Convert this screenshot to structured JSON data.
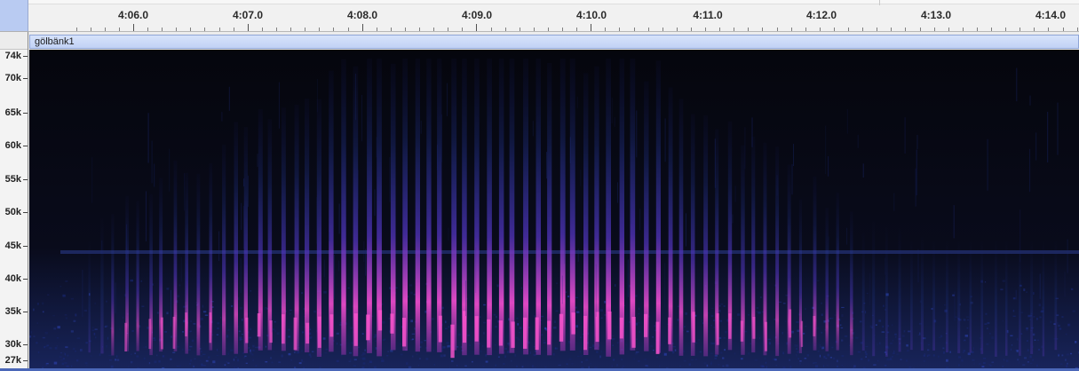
{
  "timeline": {
    "ticks": [
      {
        "label": "4:06.0"
      },
      {
        "label": "4:07.0"
      },
      {
        "label": "4:08.0"
      },
      {
        "label": "4:09.0"
      },
      {
        "label": "4:10.0"
      },
      {
        "label": "4:11.0"
      },
      {
        "label": "4:12.0"
      },
      {
        "label": "4:13.0"
      },
      {
        "label": "4:14.0"
      }
    ]
  },
  "track": {
    "name": "gölbänk1"
  },
  "frequency_axis": {
    "labels": [
      "74k",
      "70k",
      "65k",
      "60k",
      "55k",
      "50k",
      "45k",
      "40k",
      "35k",
      "30k",
      "27k"
    ]
  },
  "spectrogram": {
    "background": "#0a0b16",
    "accent_colors": {
      "low": "#1b2f8f",
      "mid": "#5b35c4",
      "high": "#e34bc5"
    }
  }
}
